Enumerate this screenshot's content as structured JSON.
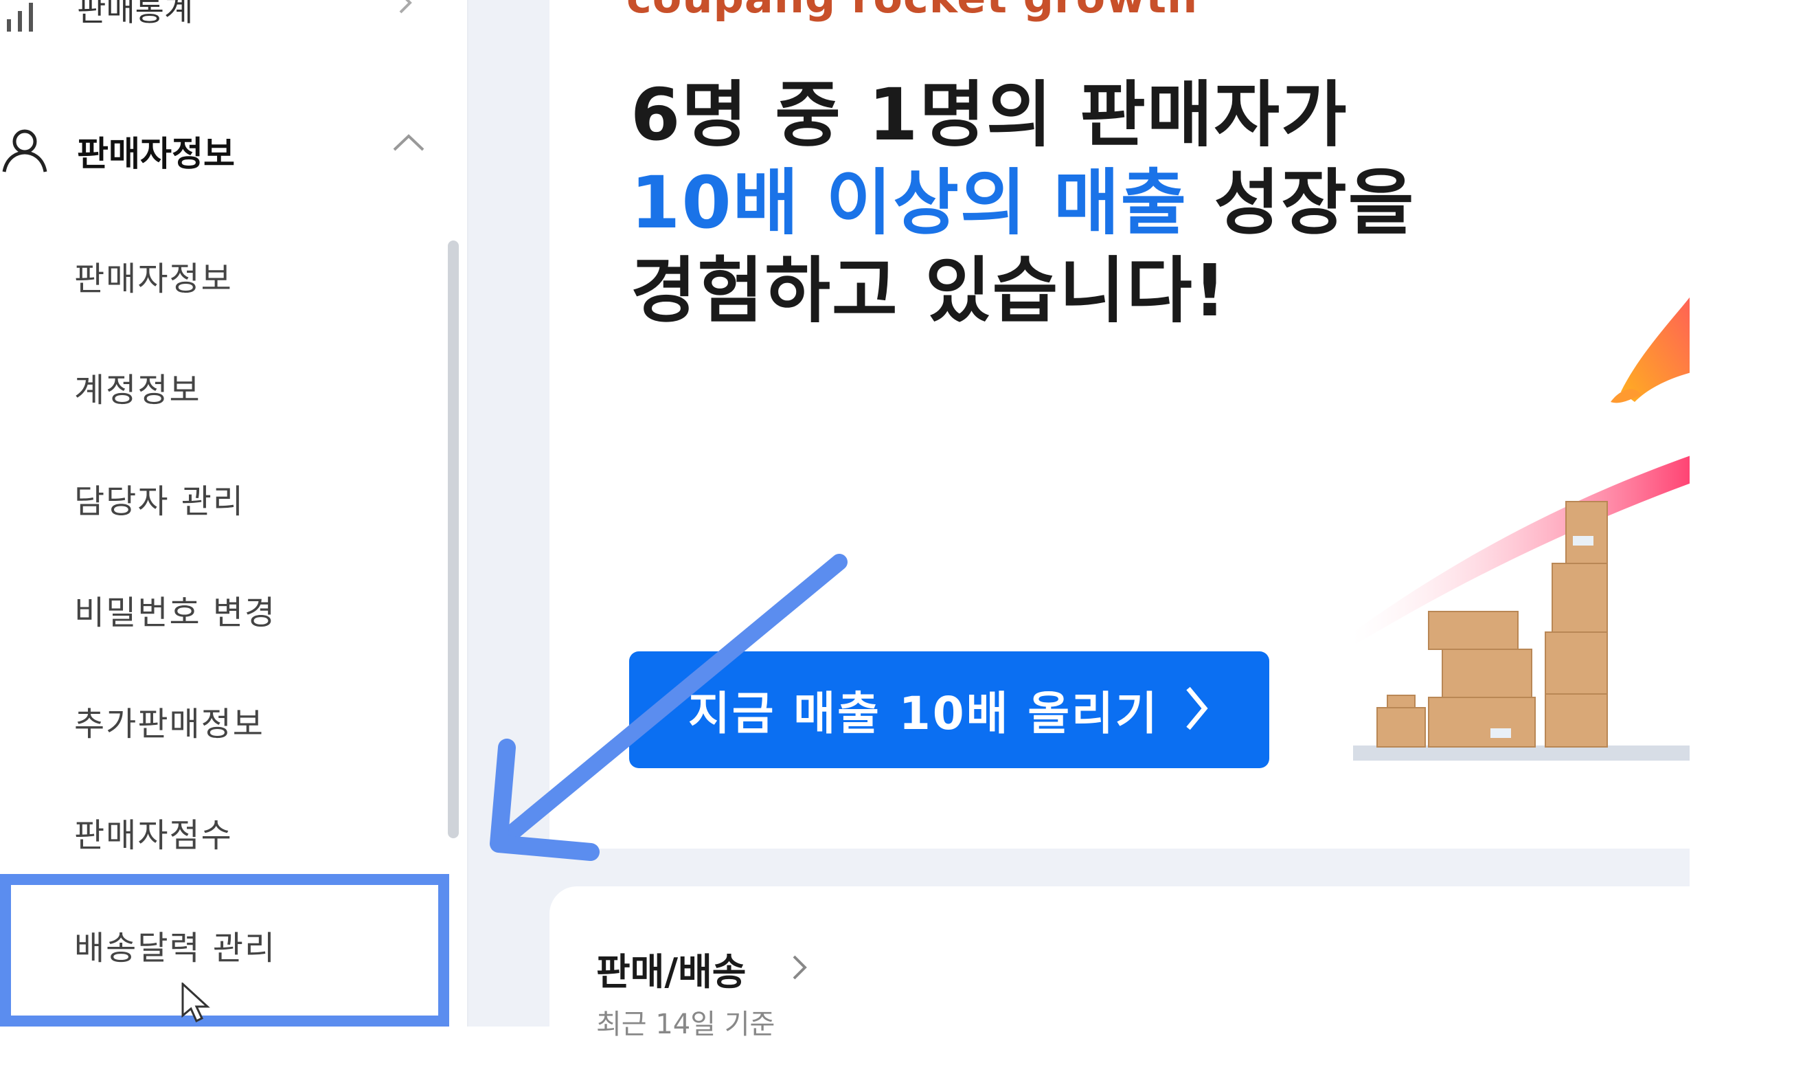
{
  "sidebar": {
    "top_item": {
      "label": "판매통계",
      "icon": "bar-chart-icon"
    },
    "section": {
      "label": "판매자정보",
      "icon": "user-icon",
      "expanded": true
    },
    "sub_items": [
      {
        "label": "판매자정보"
      },
      {
        "label": "계정정보"
      },
      {
        "label": "담당자 관리"
      },
      {
        "label": "비밀번호 변경"
      },
      {
        "label": "추가판매정보"
      },
      {
        "label": "판매자점수"
      },
      {
        "label": "배송달력 관리"
      }
    ],
    "highlighted_item": "배송달력 관리"
  },
  "banner": {
    "brand": "coupang rocket growth",
    "headline_line1": "6명 중 1명의 판매자가",
    "headline_line2_highlight": "10배 이상의 매출",
    "headline_line2_rest": " 성장을",
    "headline_line3": "경험하고 있습니다!",
    "cta_label": "지금 매출 10배 올리기"
  },
  "card": {
    "title": "판매/배송",
    "subtitle": "최근 14일 기준"
  },
  "colors": {
    "accent_blue": "#0b6ff2",
    "headline_blue": "#1a73e8",
    "highlight_box": "#5b8def",
    "annotation_arrow": "#5b8def"
  }
}
